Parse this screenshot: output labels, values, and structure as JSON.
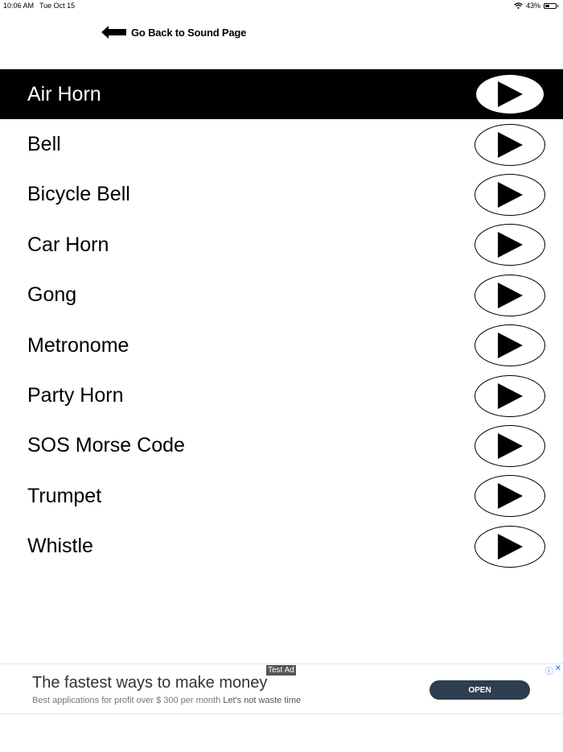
{
  "status_bar": {
    "time": "10:06 AM",
    "date": "Tue Oct 15",
    "battery_percent_label": "43%",
    "battery_level": 0.43
  },
  "back_link": {
    "label": "Go Back to Sound Page"
  },
  "sounds": [
    {
      "name": "Air Horn",
      "active": true
    },
    {
      "name": "Bell",
      "active": false
    },
    {
      "name": "Bicycle Bell",
      "active": false
    },
    {
      "name": "Car Horn",
      "active": false
    },
    {
      "name": "Gong",
      "active": false
    },
    {
      "name": "Metronome",
      "active": false
    },
    {
      "name": "Party Horn",
      "active": false
    },
    {
      "name": "SOS Morse Code",
      "active": false
    },
    {
      "name": "Trumpet",
      "active": false
    },
    {
      "name": "Whistle",
      "active": false
    }
  ],
  "ad": {
    "tag": "Test Ad",
    "headline": "The fastest ways to make money",
    "subtext": "Best applications for profit over $ 300 per month",
    "subtext_extra": "Let's not waste time",
    "cta": "OPEN"
  },
  "colors": {
    "active_row": "#000000",
    "ad_button": "#2e3d4f",
    "ad_icons": "#1a73e8"
  },
  "icons": {
    "back": "left-arrow-icon",
    "play": "play-icon",
    "wifi": "wifi-icon",
    "battery": "battery-icon"
  }
}
